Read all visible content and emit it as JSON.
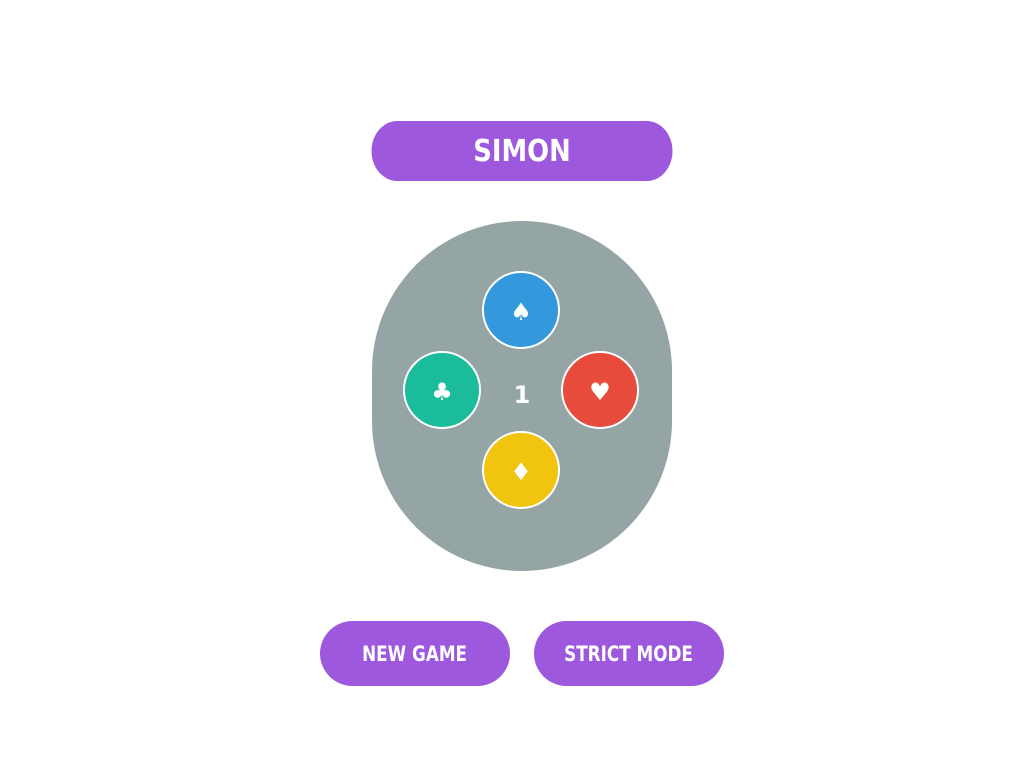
{
  "header": {
    "title": "SIMON"
  },
  "board": {
    "counter": "1",
    "buttons": [
      {
        "suit": "spade-icon",
        "glyph": "♠",
        "color": "#3498dc"
      },
      {
        "suit": "club-icon",
        "glyph": "♣",
        "color": "#1abc9c"
      },
      {
        "suit": "heart-icon",
        "glyph": "♥",
        "color": "#e74b3c"
      },
      {
        "suit": "diamond-icon",
        "glyph": "♦",
        "color": "#f1c40f"
      }
    ],
    "color": "#95a5a5"
  },
  "controls": {
    "new_game_label": "NEW GAME",
    "strict_mode_label": "STRICT MODE",
    "accent": "#9d58dd"
  }
}
